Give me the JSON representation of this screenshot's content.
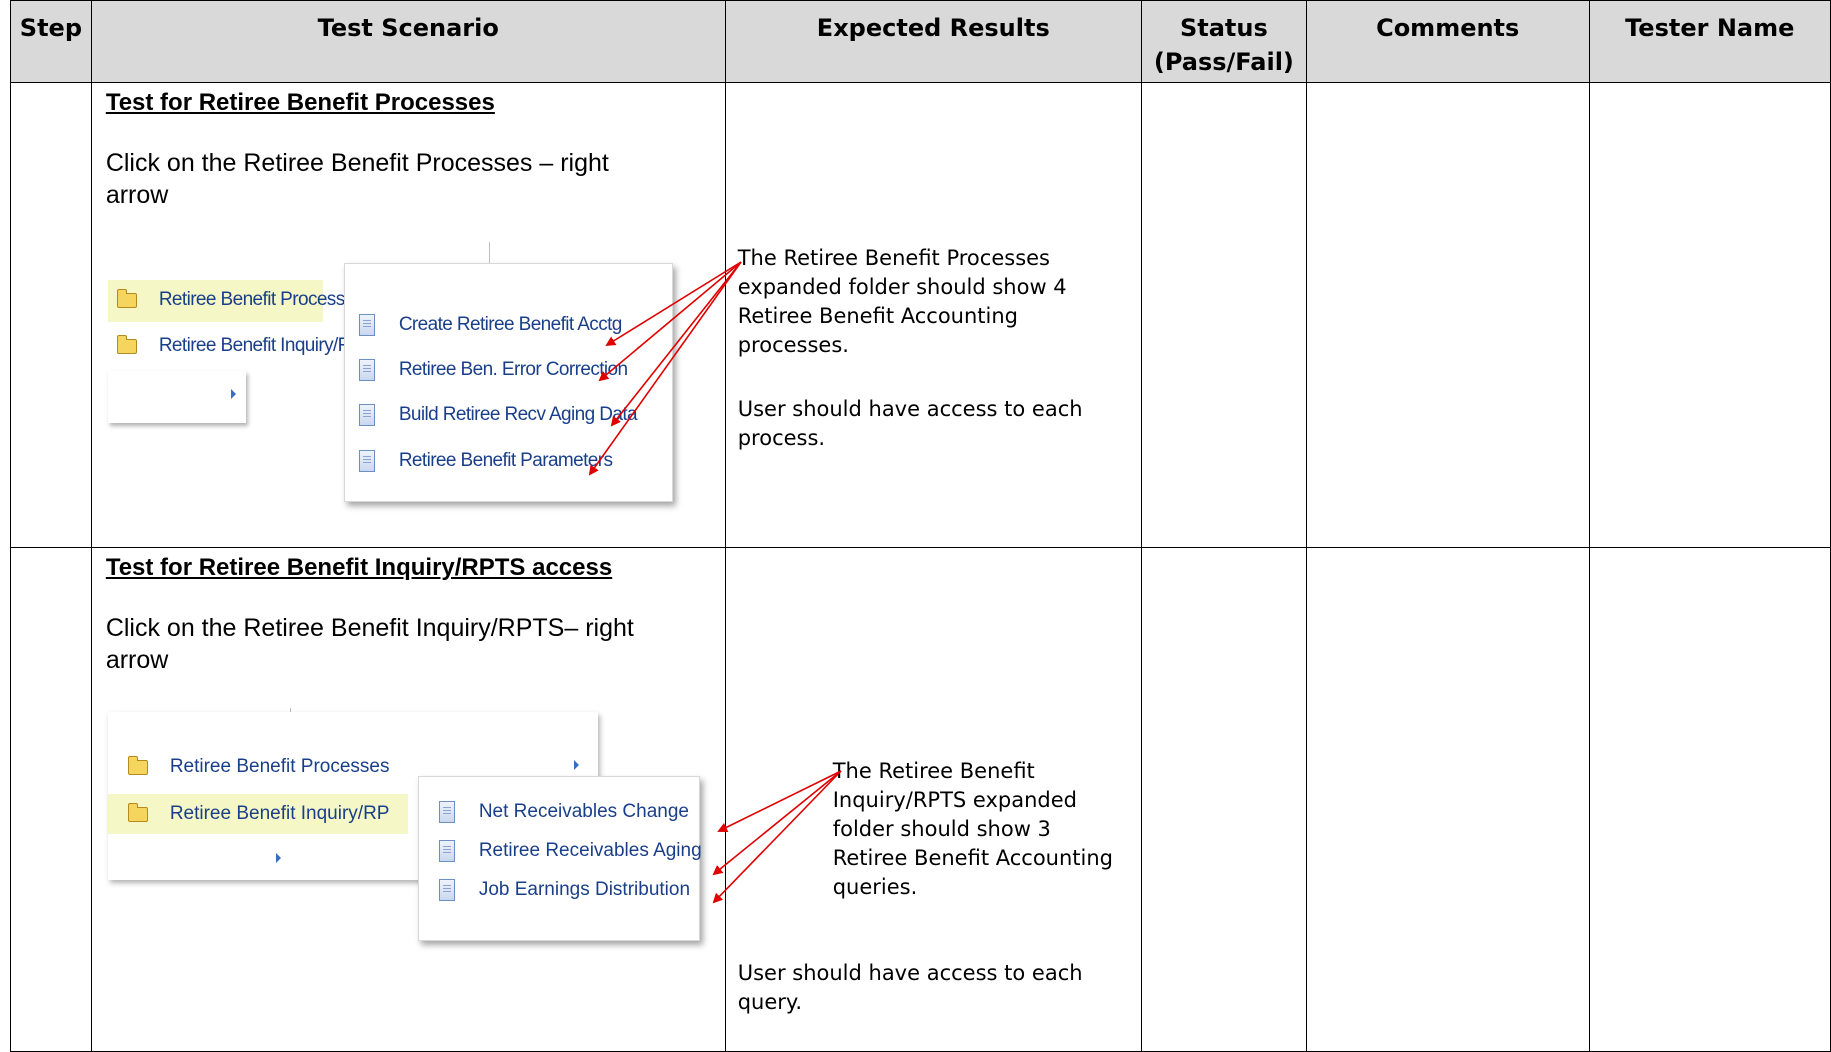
{
  "headers": {
    "step": "Step",
    "scenario": "Test Scenario",
    "expected": "Expected Results",
    "status": "Status (Pass/Fail)",
    "comments": "Comments",
    "tester": "Tester Name"
  },
  "rows": [
    {
      "title": "Test for Retiree Benefit Processes",
      "instruction": "Click on the Retiree Benefit Processes – right arrow",
      "menu": {
        "folders": [
          "Retiree Benefit Processes",
          "Retiree Benefit Inquiry/RP"
        ],
        "items": [
          "Create Retiree Benefit Acctg",
          "Retiree Ben. Error Correction",
          "Build Retiree Recv Aging Data",
          "Retiree Benefit Parameters"
        ]
      },
      "expected_lines": [
        "The Retiree Benefit Processes",
        "expanded folder should show 4",
        "Retiree Benefit Accounting",
        "processes."
      ],
      "access_lines": [
        "User should have access to each",
        "process."
      ]
    },
    {
      "title": "Test for Retiree Benefit Inquiry/RPTS access",
      "instruction": "Click on the Retiree Benefit Inquiry/RPTS– right arrow",
      "menu": {
        "folders": [
          "Retiree Benefit Processes",
          "Retiree Benefit Inquiry/RP"
        ],
        "items": [
          "Net Receivables Change",
          "Retiree Receivables Aging",
          "Job Earnings Distribution"
        ]
      },
      "expected_lines": [
        "The Retiree Benefit",
        "Inquiry/RPTS expanded",
        "folder should show 3",
        "Retiree Benefit Accounting",
        "queries."
      ],
      "access_lines": [
        "User should have access to each",
        "query."
      ]
    }
  ],
  "colors": {
    "header_bg": "#d9d9d9",
    "link": "#1a3f8a",
    "highlight": "#f5f7c6",
    "annotation_arrow": "#e00000"
  }
}
